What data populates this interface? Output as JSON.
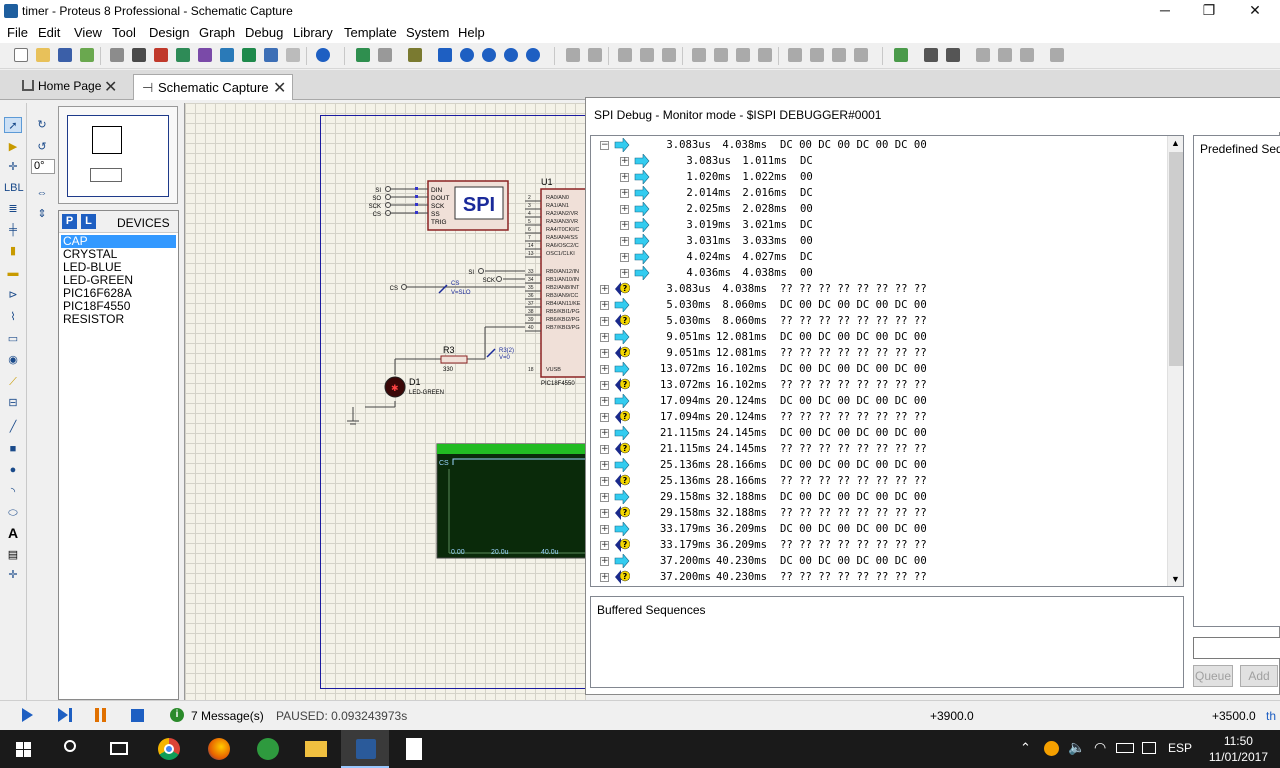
{
  "window": {
    "title": "timer - Proteus 8 Professional - Schematic Capture",
    "minimize": "─",
    "maximize": "❐",
    "close": "✕"
  },
  "menu": [
    "File",
    "Edit",
    "View",
    "Tool",
    "Design",
    "Graph",
    "Debug",
    "Library",
    "Template",
    "System",
    "Help"
  ],
  "tabs": [
    {
      "label": "Home Page"
    },
    {
      "label": "Schematic Capture"
    }
  ],
  "device_panel": {
    "p_label": "P",
    "l_label": "L",
    "title": "DEVICES",
    "items": [
      "CAP",
      "CRYSTAL",
      "LED-BLUE",
      "LED-GREEN",
      "PIC16F628A",
      "PIC18F4550",
      "RESISTOR"
    ],
    "selected": "CAP",
    "rotation": "0°"
  },
  "schematic": {
    "spi_label": "SPI",
    "spi_pins": [
      "DIN",
      "DOUT",
      "SCK",
      "SS",
      "TRIG"
    ],
    "spi_nets": [
      "SI",
      "SO",
      "SCK",
      "CS"
    ],
    "u1_label": "U1",
    "u1_part": "PIC18F4550",
    "u1_pins": [
      "RA0/AN0",
      "RA1/AN1",
      "RA2/AN2/VR",
      "RA3/AN3/VR",
      "RA4/T0CKI/C",
      "RA5/AN4/SS",
      "RA6/OSC2/C",
      "OSC1/CLKI",
      "RB0/AN12/IN",
      "RB1/AN10/IN",
      "RB2/AN8/INT",
      "RB3/AN9/CC",
      "RB4/AN11/KE",
      "RB5/KBI1/PG",
      "RB6/KBI2/PG",
      "RB7/KBI3/PG",
      "VUSB"
    ],
    "u1_pin_numbers": [
      "2",
      "3",
      "4",
      "5",
      "6",
      "7",
      "14",
      "13",
      "33",
      "34",
      "35",
      "36",
      "37",
      "38",
      "39",
      "40",
      "18"
    ],
    "probe_labels": [
      "CS",
      "V=SLO",
      "R3(2)",
      "V=0"
    ],
    "mid_nets": [
      "SI",
      "SCK",
      "CS"
    ],
    "r3_label": "R3",
    "r3_value": "330",
    "d1_label": "D1",
    "d1_part": "LED-GREEN",
    "scope_channel": "CS",
    "scope_ticks": [
      "0.00",
      "20.0u",
      "40.0u"
    ]
  },
  "spi_debug": {
    "title": "SPI Debug - Monitor mode - $ISPI DEBUGGER#0001",
    "rows": [
      {
        "level": 0,
        "exp": "−",
        "icon": "arrow",
        "t1": "3.083us",
        "t2": "4.038ms",
        "data": "DC 00 DC 00 DC 00 DC 00"
      },
      {
        "level": 1,
        "exp": "+",
        "icon": "arrow",
        "t1": "3.083us",
        "t2": "1.011ms",
        "data": "DC"
      },
      {
        "level": 1,
        "exp": "+",
        "icon": "arrow",
        "t1": "1.020ms",
        "t2": "1.022ms",
        "data": "00"
      },
      {
        "level": 1,
        "exp": "+",
        "icon": "arrow",
        "t1": "2.014ms",
        "t2": "2.016ms",
        "data": "DC"
      },
      {
        "level": 1,
        "exp": "+",
        "icon": "arrow",
        "t1": "2.025ms",
        "t2": "2.028ms",
        "data": "00"
      },
      {
        "level": 1,
        "exp": "+",
        "icon": "arrow",
        "t1": "3.019ms",
        "t2": "3.021ms",
        "data": "DC"
      },
      {
        "level": 1,
        "exp": "+",
        "icon": "arrow",
        "t1": "3.031ms",
        "t2": "3.033ms",
        "data": "00"
      },
      {
        "level": 1,
        "exp": "+",
        "icon": "arrow",
        "t1": "4.024ms",
        "t2": "4.027ms",
        "data": "DC"
      },
      {
        "level": 1,
        "exp": "+",
        "icon": "arrow",
        "t1": "4.036ms",
        "t2": "4.038ms",
        "data": "00"
      },
      {
        "level": 0,
        "exp": "+",
        "icon": "query",
        "t1": "3.083us",
        "t2": "4.038ms",
        "data": "?? ?? ?? ?? ?? ?? ?? ??"
      },
      {
        "level": 0,
        "exp": "+",
        "icon": "arrow",
        "t1": "5.030ms",
        "t2": "8.060ms",
        "data": "DC 00 DC 00 DC 00 DC 00"
      },
      {
        "level": 0,
        "exp": "+",
        "icon": "query",
        "t1": "5.030ms",
        "t2": "8.060ms",
        "data": "?? ?? ?? ?? ?? ?? ?? ??"
      },
      {
        "level": 0,
        "exp": "+",
        "icon": "arrow",
        "t1": "9.051ms",
        "t2": "12.081ms",
        "data": "DC 00 DC 00 DC 00 DC 00"
      },
      {
        "level": 0,
        "exp": "+",
        "icon": "query",
        "t1": "9.051ms",
        "t2": "12.081ms",
        "data": "?? ?? ?? ?? ?? ?? ?? ??"
      },
      {
        "level": 0,
        "exp": "+",
        "icon": "arrow",
        "t1": "13.072ms",
        "t2": "16.102ms",
        "data": "DC 00 DC 00 DC 00 DC 00"
      },
      {
        "level": 0,
        "exp": "+",
        "icon": "query",
        "t1": "13.072ms",
        "t2": "16.102ms",
        "data": "?? ?? ?? ?? ?? ?? ?? ??"
      },
      {
        "level": 0,
        "exp": "+",
        "icon": "arrow",
        "t1": "17.094ms",
        "t2": "20.124ms",
        "data": "DC 00 DC 00 DC 00 DC 00"
      },
      {
        "level": 0,
        "exp": "+",
        "icon": "query",
        "t1": "17.094ms",
        "t2": "20.124ms",
        "data": "?? ?? ?? ?? ?? ?? ?? ??"
      },
      {
        "level": 0,
        "exp": "+",
        "icon": "arrow",
        "t1": "21.115ms",
        "t2": "24.145ms",
        "data": "DC 00 DC 00 DC 00 DC 00"
      },
      {
        "level": 0,
        "exp": "+",
        "icon": "query",
        "t1": "21.115ms",
        "t2": "24.145ms",
        "data": "?? ?? ?? ?? ?? ?? ?? ??"
      },
      {
        "level": 0,
        "exp": "+",
        "icon": "arrow",
        "t1": "25.136ms",
        "t2": "28.166ms",
        "data": "DC 00 DC 00 DC 00 DC 00"
      },
      {
        "level": 0,
        "exp": "+",
        "icon": "query",
        "t1": "25.136ms",
        "t2": "28.166ms",
        "data": "?? ?? ?? ?? ?? ?? ?? ??"
      },
      {
        "level": 0,
        "exp": "+",
        "icon": "arrow",
        "t1": "29.158ms",
        "t2": "32.188ms",
        "data": "DC 00 DC 00 DC 00 DC 00"
      },
      {
        "level": 0,
        "exp": "+",
        "icon": "query",
        "t1": "29.158ms",
        "t2": "32.188ms",
        "data": "?? ?? ?? ?? ?? ?? ?? ??"
      },
      {
        "level": 0,
        "exp": "+",
        "icon": "arrow",
        "t1": "33.179ms",
        "t2": "36.209ms",
        "data": "DC 00 DC 00 DC 00 DC 00"
      },
      {
        "level": 0,
        "exp": "+",
        "icon": "query",
        "t1": "33.179ms",
        "t2": "36.209ms",
        "data": "?? ?? ?? ?? ?? ?? ?? ??"
      },
      {
        "level": 0,
        "exp": "+",
        "icon": "arrow",
        "t1": "37.200ms",
        "t2": "40.230ms",
        "data": "DC 00 DC 00 DC 00 DC 00"
      },
      {
        "level": 0,
        "exp": "+",
        "icon": "query",
        "t1": "37.200ms",
        "t2": "40.230ms",
        "data": "?? ?? ?? ?? ?? ?? ?? ??"
      }
    ],
    "buffered_label": "Buffered Sequences",
    "predefined_label": "Predefined Seq",
    "queue_label": "Queue",
    "add_label": "Add"
  },
  "statusbar": {
    "messages": "7 Message(s)",
    "paused": "PAUSED: 0.093243973s",
    "coord_x": "+3900.0",
    "coord_y": "+3500.0",
    "unit": "th"
  },
  "taskbar": {
    "time": "11:50",
    "date": "11/01/2017",
    "lang": "ESP"
  },
  "colors": {
    "accent": "#3399ff",
    "arrow": "#33ccf0",
    "query": "#1a2a8c",
    "scope_bg": "#0a2a0a",
    "scope_header": "#22bb22"
  }
}
